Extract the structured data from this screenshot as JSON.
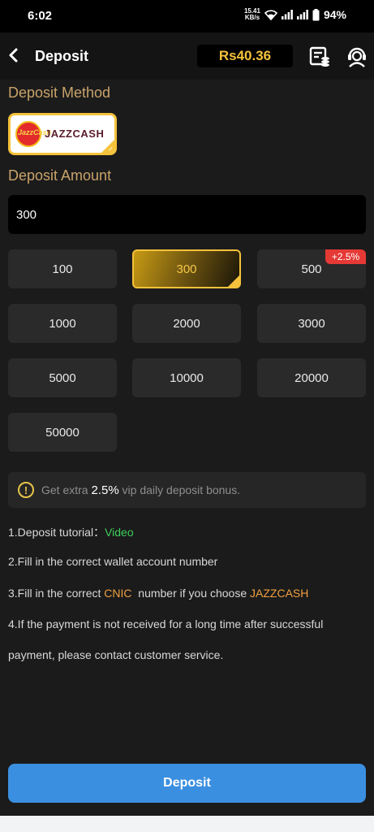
{
  "status_bar": {
    "time": "6:02",
    "net_speed_value": "15.41",
    "net_speed_unit": "KB/s",
    "battery": "94%"
  },
  "header": {
    "title": "Deposit",
    "balance": "Rs40.36",
    "icons": [
      "records-icon",
      "customer-service-icon"
    ]
  },
  "deposit_method": {
    "label": "Deposit Method",
    "selected": {
      "logo_text": "JazzCash",
      "name": "JAZZCASH"
    }
  },
  "deposit_amount": {
    "label": "Deposit Amount",
    "value": "300",
    "options": [
      {
        "amount": "100"
      },
      {
        "amount": "300",
        "selected": true
      },
      {
        "amount": "500",
        "badge": "+2.5%"
      },
      {
        "amount": "1000"
      },
      {
        "amount": "2000"
      },
      {
        "amount": "3000"
      },
      {
        "amount": "5000"
      },
      {
        "amount": "10000"
      },
      {
        "amount": "20000"
      },
      {
        "amount": "50000"
      }
    ]
  },
  "notice": {
    "prefix": "Get extra ",
    "highlight": "2.5%",
    "suffix": " vip daily deposit bonus."
  },
  "instructions": {
    "line1_text": "1.Deposit tutorial：",
    "line1_link": "Video",
    "line2": "2.Fill in the correct wallet account number",
    "line3_a": "3.Fill in the correct ",
    "line3_cnic": "CNIC",
    "line3_b": "  number if you choose ",
    "line3_method": "JAZZCASH",
    "line4a": "4.If the payment is not received for a long time after successful",
    "line4b": "payment, please contact customer service."
  },
  "deposit_button": "Deposit",
  "colors": {
    "accent_gold": "#f4c23b",
    "label_gold": "#c9a36a",
    "primary_blue": "#3b8fe0",
    "badge_red": "#e53935",
    "link_green": "#3ecf5a",
    "highlight_orange": "#f0a040"
  }
}
